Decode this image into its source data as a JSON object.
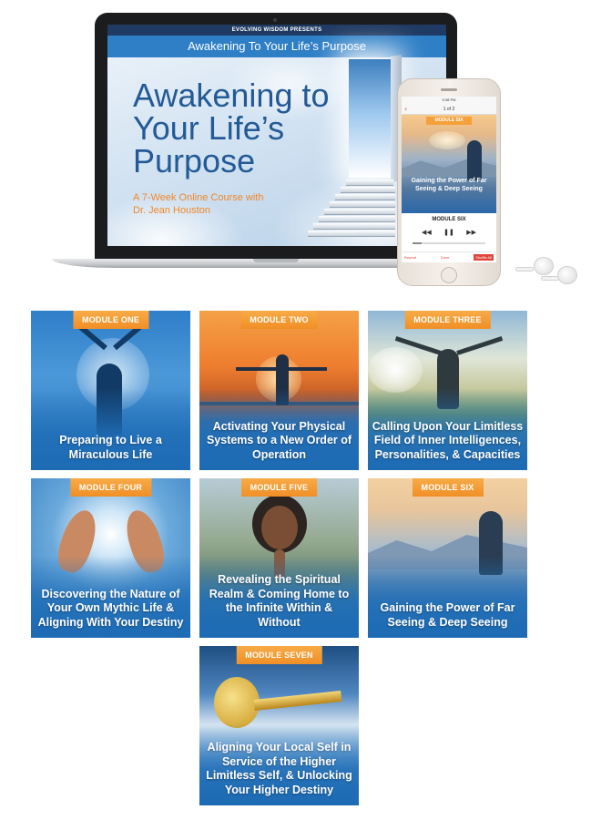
{
  "laptop": {
    "presenter": "EVOLVING WISDOM PRESENTS",
    "banner_title": "Awakening To Your Life’s Purpose",
    "heading_line1": "Awakening to",
    "heading_line2": "Your Life’s",
    "heading_line3": "Purpose",
    "subtitle_line1": "A 7-Week Online Course with",
    "subtitle_line2": "Dr. Jean Houston"
  },
  "phone": {
    "status_time": "9:38 PM",
    "nav_title": "1 of 2",
    "back_icon": "chevron-left-icon",
    "art_tag": "MODULE SIX",
    "art_title": "Gaining the Power of Far Seeing & Deep Seeing",
    "player_label": "MODULE SIX",
    "rewind_icon": "rewind-icon",
    "pause_icon": "pause-icon",
    "forward_icon": "fast-forward-icon",
    "progress": 0.12,
    "footer_left": "Repeat",
    "footer_mid": "Done",
    "footer_right": "Shuffle All"
  },
  "modules": [
    {
      "tag": "MODULE ONE",
      "title": "Preparing to Live a Miraculous Life"
    },
    {
      "tag": "MODULE TWO",
      "title": "Activating Your Physical Systems to a New Order of Operation"
    },
    {
      "tag": "MODULE THREE",
      "title": "Calling Upon Your Limitless Field of Inner Intelligences, Personalities, & Capacities"
    },
    {
      "tag": "MODULE FOUR",
      "title": "Discovering the Nature of Your Own Mythic Life & Aligning With Your Destiny"
    },
    {
      "tag": "MODULE FIVE",
      "title": "Revealing the Spiritual Realm & Coming Home to the Infinite Within & Without"
    },
    {
      "tag": "MODULE SIX",
      "title": "Gaining the Power of Far Seeing & Deep Seeing"
    },
    {
      "tag": "MODULE SEVEN",
      "title": "Aligning Your Local Self in Service of the Higher Limitless Self, & Unlocking Your Higher Destiny"
    }
  ],
  "colors": {
    "tag_orange": "#f08f26",
    "tile_blue": "#1d6bb4",
    "heading_blue": "#235a96",
    "banner_blue": "#2e7fc6"
  }
}
